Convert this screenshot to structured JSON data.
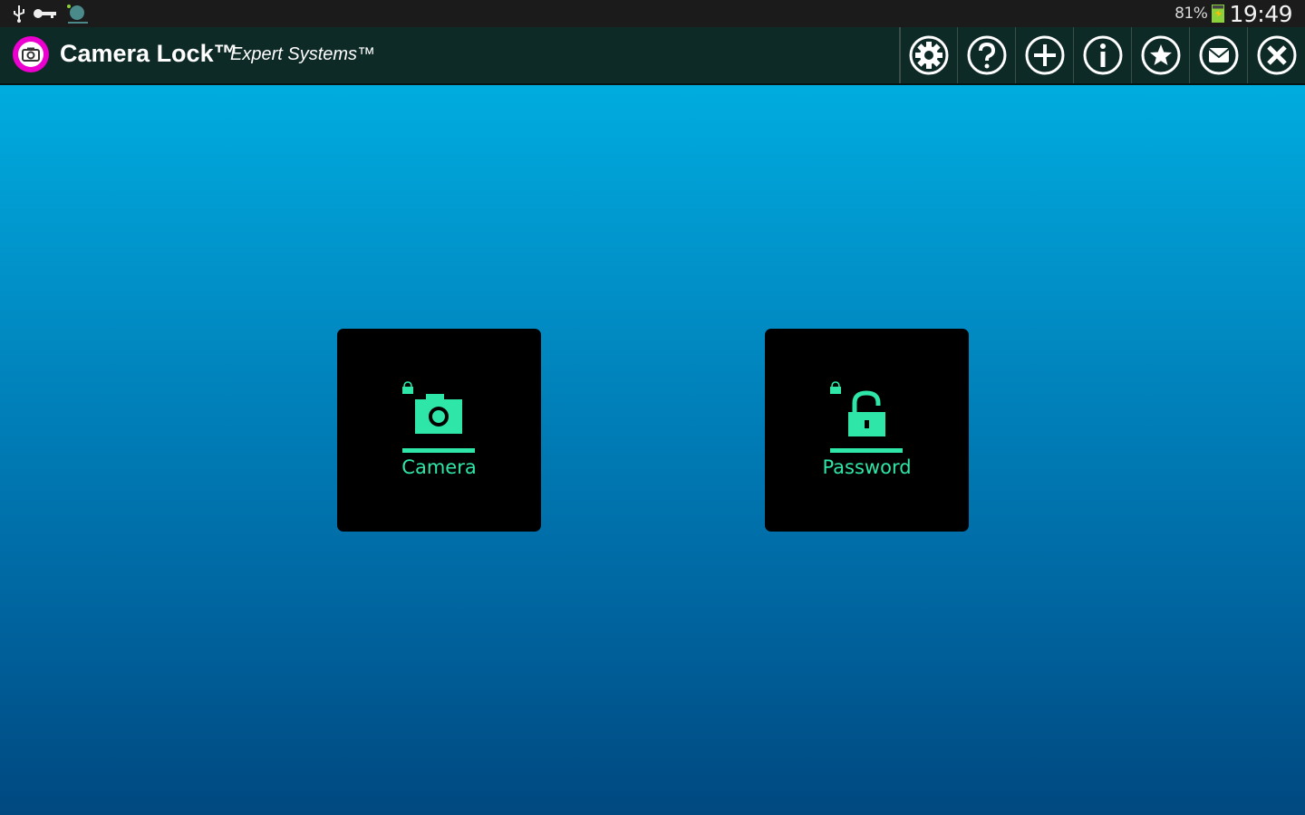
{
  "status_bar": {
    "icons": [
      "usb-icon",
      "key-icon",
      "app-notification-icon"
    ],
    "battery_percent": "81%",
    "time": "19:49"
  },
  "app_bar": {
    "title": "Camera Lock™",
    "subtitle": "Expert Systems™",
    "app_icon": "camera-app-icon",
    "actions": [
      {
        "icon": "settings-icon"
      },
      {
        "icon": "help-icon"
      },
      {
        "icon": "add-icon"
      },
      {
        "icon": "info-icon"
      },
      {
        "icon": "star-icon"
      },
      {
        "icon": "mail-icon"
      },
      {
        "icon": "close-icon"
      }
    ]
  },
  "tiles": [
    {
      "label": "Camera",
      "icon": "camera-icon",
      "lock_state": "locked"
    },
    {
      "label": "Password",
      "icon": "unlocked-padlock-icon",
      "lock_state": "unlocked"
    }
  ],
  "colors": {
    "accent_green": "#2ee6a8",
    "app_bar_bg": "#0e2a26",
    "status_bar_bg": "#1b1b1b",
    "app_icon_magenta": "#ec00d0",
    "background_top": "#00b8e8",
    "background_bottom": "#004880",
    "tile_bg": "#000000"
  }
}
